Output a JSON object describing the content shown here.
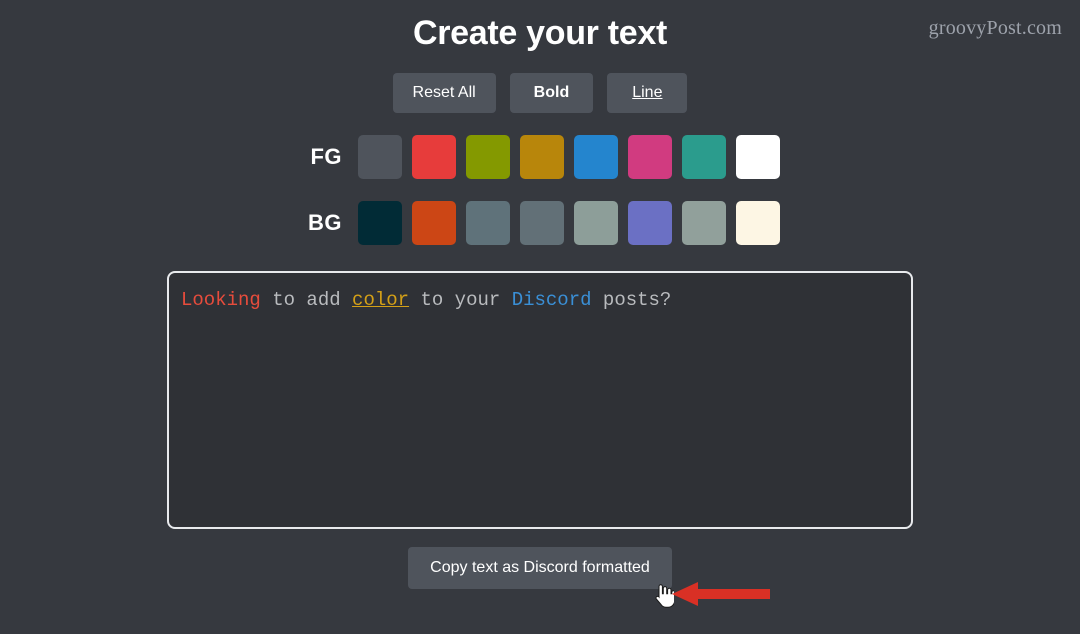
{
  "watermark": "groovyPost.com",
  "header": {
    "title": "Create your text"
  },
  "toolbar": {
    "reset_label": "Reset All",
    "bold_label": "Bold",
    "line_label": "Line"
  },
  "palettes": {
    "fg": {
      "label": "FG",
      "swatches": [
        {
          "name": "fg-swatch-gray",
          "color": "#4f545c"
        },
        {
          "name": "fg-swatch-red",
          "color": "#e73c3b"
        },
        {
          "name": "fg-swatch-olive",
          "color": "#849900"
        },
        {
          "name": "fg-swatch-gold",
          "color": "#b8860b"
        },
        {
          "name": "fg-swatch-blue",
          "color": "#2485ce"
        },
        {
          "name": "fg-swatch-pink",
          "color": "#d13b80"
        },
        {
          "name": "fg-swatch-teal",
          "color": "#2b9c8d"
        },
        {
          "name": "fg-swatch-white",
          "color": "#ffffff"
        }
      ]
    },
    "bg": {
      "label": "BG",
      "swatches": [
        {
          "name": "bg-swatch-dark-teal",
          "color": "#012b36"
        },
        {
          "name": "bg-swatch-orange",
          "color": "#cc4615"
        },
        {
          "name": "bg-swatch-slate",
          "color": "#5f727a"
        },
        {
          "name": "bg-swatch-slate-gray",
          "color": "#627077"
        },
        {
          "name": "bg-swatch-gray-green",
          "color": "#8d9e99"
        },
        {
          "name": "bg-swatch-purple",
          "color": "#6b70c4"
        },
        {
          "name": "bg-swatch-gray-green-2",
          "color": "#91a09b"
        },
        {
          "name": "bg-swatch-cream",
          "color": "#fdf6e4"
        }
      ]
    }
  },
  "editor": {
    "tokens": [
      {
        "text": "Looking",
        "style": "red"
      },
      {
        "text": " to add ",
        "style": "plain"
      },
      {
        "text": "color",
        "style": "gold"
      },
      {
        "text": " to your ",
        "style": "plain"
      },
      {
        "text": "Discord",
        "style": "blue"
      },
      {
        "text": " posts?",
        "style": "plain"
      }
    ],
    "full_text": "Looking to add color to your Discord posts?"
  },
  "footer": {
    "copy_label": "Copy text as Discord formatted"
  },
  "annotation": {
    "arrow_color": "#d93025"
  }
}
